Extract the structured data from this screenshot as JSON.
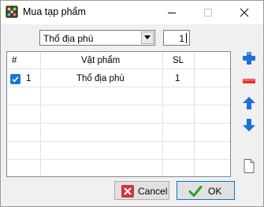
{
  "window": {
    "title": "Mua tạp phẩm",
    "icon": "app-dice-icon"
  },
  "form": {
    "item_value": "Thổ địa phù",
    "quantity": "1"
  },
  "table": {
    "columns": [
      "#",
      "Vật phẩm",
      "SL"
    ],
    "rows": [
      {
        "checked": true,
        "index": "1",
        "item": "Thổ địa phù",
        "qty": "1"
      }
    ]
  },
  "side_buttons": [
    "plus-icon",
    "minus-icon",
    "arrow-up-icon",
    "arrow-down-icon",
    "new-file-icon"
  ],
  "buttons": {
    "cancel_label": "Cancel",
    "ok_label": "OK"
  },
  "colors": {
    "accent": "#1976d2",
    "plus": "#1e6fd9",
    "minus": "#e0352b",
    "ok_green": "#2e9e2e",
    "cancel_red": "#d23434"
  }
}
